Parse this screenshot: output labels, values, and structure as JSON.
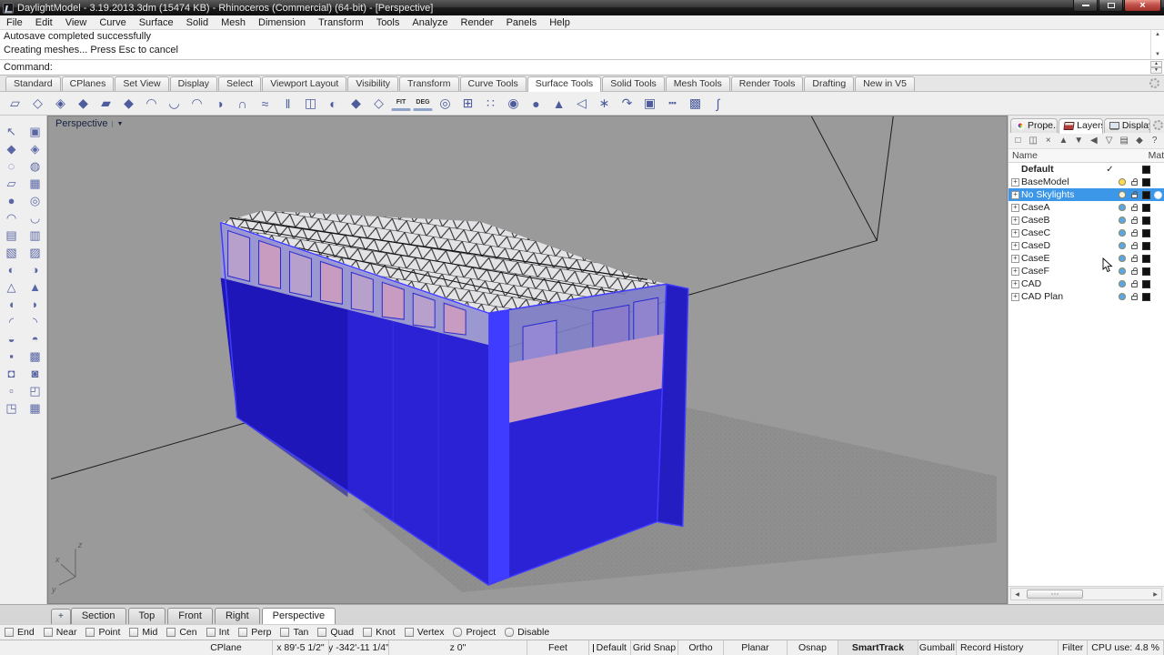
{
  "colors": {
    "viewport_bg": "#9a9a9a",
    "building_blue": "#2b22d6",
    "building_dark": "#140da0",
    "building_bright": "#3f3bff",
    "clerestory": "#9a97d6",
    "interior_pink": "#c79cc0",
    "truss_base": "#e3e3e6",
    "selection_blue": "#3d97e8",
    "shadow_gray": "#8d8d8d"
  },
  "icons": {
    "close": "×",
    "scroll_up": "▲",
    "scroll_down": "▼",
    "spin_up": "▲",
    "spin_down": "▼",
    "dropdown": "▼",
    "add_tab": "+",
    "scroll_left": "◀",
    "scroll_right": "▶"
  },
  "window": {
    "title": "DaylightModel - 3.19.2013.3dm (15474 KB) - Rhinoceros (Commercial) (64-bit) - [Perspective]"
  },
  "menu": [
    "File",
    "Edit",
    "View",
    "Curve",
    "Surface",
    "Solid",
    "Mesh",
    "Dimension",
    "Transform",
    "Tools",
    "Analyze",
    "Render",
    "Panels",
    "Help"
  ],
  "command": {
    "history": [
      "Autosave completed successfully",
      "Creating meshes... Press Esc to cancel"
    ],
    "prompt": "Command:"
  },
  "toolbar_tabs": [
    {
      "label": "Standard"
    },
    {
      "label": "CPlanes"
    },
    {
      "label": "Set View"
    },
    {
      "label": "Display"
    },
    {
      "label": "Select"
    },
    {
      "label": "Viewport Layout"
    },
    {
      "label": "Visibility"
    },
    {
      "label": "Transform"
    },
    {
      "label": "Curve Tools"
    },
    {
      "label": "Surface Tools",
      "active": true
    },
    {
      "label": "Solid Tools"
    },
    {
      "label": "Mesh Tools"
    },
    {
      "label": "Render Tools"
    },
    {
      "label": "Drafting"
    },
    {
      "label": "New in V5"
    }
  ],
  "toolbar_icons": [
    {
      "name": "surface-3pt",
      "glyph": "▱"
    },
    {
      "name": "surface-corner-points",
      "glyph": "◇"
    },
    {
      "name": "surface-from-edges",
      "glyph": "◈"
    },
    {
      "name": "loft",
      "glyph": "◆"
    },
    {
      "name": "extrude-straight",
      "glyph": "▰"
    },
    {
      "name": "extrude-along-curve",
      "glyph": "◆"
    },
    {
      "name": "revolve",
      "glyph": "◠"
    },
    {
      "name": "sweep-1-rail",
      "glyph": "◡"
    },
    {
      "name": "sweep-2-rails",
      "glyph": "◠"
    },
    {
      "name": "patch",
      "glyph": "◑"
    },
    {
      "name": "drape",
      "glyph": "∩"
    },
    {
      "name": "blend-surface",
      "glyph": "≈"
    },
    {
      "name": "offset-surface",
      "glyph": "‖"
    },
    {
      "name": "match-surface",
      "glyph": "◫"
    },
    {
      "name": "merge-surface",
      "glyph": "◐"
    },
    {
      "name": "surface-tools-person-1",
      "glyph": "◆"
    },
    {
      "name": "surface-tools-person-2",
      "glyph": "◇"
    },
    {
      "name": "fit-surface",
      "glyph": "FIT",
      "text": true
    },
    {
      "name": "change-degree",
      "glyph": "DEG",
      "text": true
    },
    {
      "name": "rebuild-surface",
      "glyph": "◎"
    },
    {
      "name": "show-edges",
      "glyph": "⊞"
    },
    {
      "name": "points-on",
      "glyph": "∷"
    },
    {
      "name": "control-point-edit",
      "glyph": "◉"
    },
    {
      "name": "cylinder-srf",
      "glyph": "●"
    },
    {
      "name": "triangle-srf",
      "glyph": "▲"
    },
    {
      "name": "unroll-srf",
      "glyph": "◁"
    },
    {
      "name": "explode-srf",
      "glyph": "∗"
    },
    {
      "name": "bend-srf",
      "glyph": "↷"
    },
    {
      "name": "book-srf",
      "glyph": "▣"
    },
    {
      "name": "section-dotted",
      "glyph": "┅"
    },
    {
      "name": "analysis-map",
      "glyph": "▩"
    },
    {
      "name": "curvature-graph",
      "glyph": "∫"
    }
  ],
  "left_toolbar_icons": [
    {
      "name": "select-pointer",
      "glyph": "↖"
    },
    {
      "name": "selection-filter",
      "glyph": "▣"
    },
    {
      "name": "move",
      "glyph": "◆"
    },
    {
      "name": "copy",
      "glyph": "◈"
    },
    {
      "name": "lasso-select",
      "glyph": "◌"
    },
    {
      "name": "brush-select",
      "glyph": "◍"
    },
    {
      "name": "control-points-on",
      "glyph": "▱"
    },
    {
      "name": "points-off",
      "glyph": "▦"
    },
    {
      "name": "sphere-tool",
      "glyph": "●"
    },
    {
      "name": "paint-tool",
      "glyph": "◎"
    },
    {
      "name": "bend-tool",
      "glyph": "◠"
    },
    {
      "name": "patch-tool",
      "glyph": "◡"
    },
    {
      "name": "box-edit-1",
      "glyph": "▤"
    },
    {
      "name": "box-edit-2",
      "glyph": "▥"
    },
    {
      "name": "door-tool",
      "glyph": "▧"
    },
    {
      "name": "render-map-tool",
      "glyph": "▨"
    },
    {
      "name": "solid-union",
      "glyph": "◐"
    },
    {
      "name": "solid-difference",
      "glyph": "◑"
    },
    {
      "name": "cone-tool",
      "glyph": "△"
    },
    {
      "name": "pyramid-tool",
      "glyph": "▲"
    },
    {
      "name": "curve-left",
      "glyph": "◖"
    },
    {
      "name": "curve-right",
      "glyph": "◗"
    },
    {
      "name": "arc-1",
      "glyph": "◜"
    },
    {
      "name": "arc-2",
      "glyph": "◝"
    },
    {
      "name": "pipe-tool",
      "glyph": "◒"
    },
    {
      "name": "dome-tool",
      "glyph": "◓"
    },
    {
      "name": "plane-tool",
      "glyph": "▪"
    },
    {
      "name": "grid-points-tool",
      "glyph": "▩"
    },
    {
      "name": "extract-iso",
      "glyph": "◘"
    },
    {
      "name": "inverse-extract",
      "glyph": "◙"
    },
    {
      "name": "flatten-tool",
      "glyph": "▫"
    },
    {
      "name": "corner-tool",
      "glyph": "◰"
    },
    {
      "name": "surface-block",
      "glyph": "◳"
    },
    {
      "name": "array-tool",
      "glyph": "▦"
    }
  ],
  "viewport": {
    "label": "Perspective",
    "axis": {
      "x": "x",
      "y": "y",
      "z": "z"
    }
  },
  "panel": {
    "tabs": [
      {
        "label": "Prope...",
        "icon": "properties-icon"
      },
      {
        "label": "Layers",
        "icon": "layers-icon",
        "active": true
      },
      {
        "label": "Display",
        "icon": "display-icon"
      }
    ],
    "toolbar": [
      {
        "name": "new-layer",
        "glyph": "□"
      },
      {
        "name": "new-sublayer",
        "glyph": "◫"
      },
      {
        "name": "delete-layer",
        "glyph": "×"
      },
      {
        "name": "move-layer-up",
        "glyph": "▲"
      },
      {
        "name": "move-layer-down",
        "glyph": "▼"
      },
      {
        "name": "collapse-all",
        "glyph": "◀"
      },
      {
        "name": "filter-layers",
        "glyph": "▽"
      },
      {
        "name": "layer-report",
        "glyph": "▤"
      },
      {
        "name": "layer-tools",
        "glyph": "◆"
      },
      {
        "name": "help",
        "glyph": "?"
      }
    ],
    "columns": {
      "name": "Name",
      "material": "Mate"
    },
    "layers": [
      {
        "name": "Default",
        "bold": true,
        "check": true,
        "swatch": "#111111"
      },
      {
        "name": "BaseModel",
        "expand": true,
        "bulb": "#ffd84d",
        "lock": true,
        "swatch": "#111111"
      },
      {
        "name": "No Skylights",
        "expand": true,
        "selected": true,
        "bulb": "#f5f2df",
        "lock": true,
        "swatch": "#111111",
        "current_dot": true
      },
      {
        "name": "CaseA",
        "expand": true,
        "bulb": "#5aa7e8",
        "lock": true,
        "swatch": "#111111"
      },
      {
        "name": "CaseB",
        "expand": true,
        "bulb": "#5aa7e8",
        "lock": true,
        "swatch": "#111111"
      },
      {
        "name": "CaseC",
        "expand": true,
        "bulb": "#5aa7e8",
        "lock": true,
        "swatch": "#111111"
      },
      {
        "name": "CaseD",
        "expand": true,
        "bulb": "#5aa7e8",
        "lock": true,
        "swatch": "#111111"
      },
      {
        "name": "CaseE",
        "expand": true,
        "bulb": "#5aa7e8",
        "lock": true,
        "swatch": "#111111"
      },
      {
        "name": "CaseF",
        "expand": true,
        "bulb": "#5aa7e8",
        "lock": true,
        "swatch": "#111111"
      },
      {
        "name": "CAD",
        "expand": true,
        "bulb": "#5aa7e8",
        "lock": true,
        "swatch": "#111111"
      },
      {
        "name": "CAD Plan",
        "expand": true,
        "bulb": "#5aa7e8",
        "lock": true,
        "swatch": "#111111"
      }
    ]
  },
  "viewport_tabs": [
    {
      "label": "Section"
    },
    {
      "label": "Top"
    },
    {
      "label": "Front"
    },
    {
      "label": "Right"
    },
    {
      "label": "Perspective",
      "active": true
    }
  ],
  "osnap": [
    {
      "label": "End"
    },
    {
      "label": "Near"
    },
    {
      "label": "Point"
    },
    {
      "label": "Mid"
    },
    {
      "label": "Cen"
    },
    {
      "label": "Int"
    },
    {
      "label": "Perp"
    },
    {
      "label": "Tan"
    },
    {
      "label": "Quad"
    },
    {
      "label": "Knot"
    },
    {
      "label": "Vertex"
    },
    {
      "label": "Project",
      "rounded": true
    },
    {
      "label": "Disable",
      "rounded": true
    }
  ],
  "statusbar": [
    {
      "label": "CPlane"
    },
    {
      "label": "x 89'-5 1/2\""
    },
    {
      "label": "y -342'-11 1/4\""
    },
    {
      "label": "z 0\""
    },
    {
      "label": "Feet"
    },
    {
      "label": "Default",
      "swatch": true
    },
    {
      "label": "Grid Snap"
    },
    {
      "label": "Ortho"
    },
    {
      "label": "Planar"
    },
    {
      "label": "Osnap"
    },
    {
      "label": "SmartTrack",
      "bold": true
    },
    {
      "label": "Gumball"
    },
    {
      "label": "Record History"
    },
    {
      "label": "Filter"
    },
    {
      "label": "CPU use: 4.8 %"
    }
  ]
}
